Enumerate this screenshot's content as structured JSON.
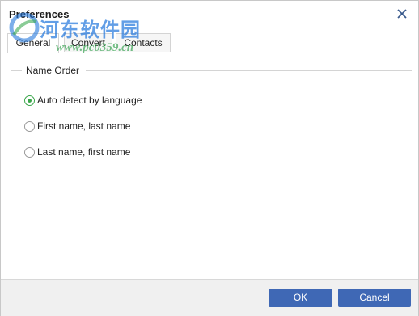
{
  "window": {
    "title": "Preferences",
    "close_icon": "close-icon"
  },
  "tabs": [
    {
      "label": "General",
      "active": true
    },
    {
      "label": "Convert",
      "active": false
    },
    {
      "label": "Contacts",
      "active": false
    }
  ],
  "name_order": {
    "group_label": "Name Order",
    "options": [
      {
        "label": "Auto detect by language",
        "checked": true
      },
      {
        "label": "First name, last name",
        "checked": false
      },
      {
        "label": "Last name, first name",
        "checked": false
      }
    ]
  },
  "buttons": {
    "ok": "OK",
    "cancel": "Cancel"
  },
  "watermark": {
    "text_cn": "河东软件园",
    "url": "www.pc0359.cn"
  },
  "colors": {
    "accent": "#3f68b5",
    "radio_selected": "#3aa64a",
    "footer_bg": "#f0f0f0"
  }
}
